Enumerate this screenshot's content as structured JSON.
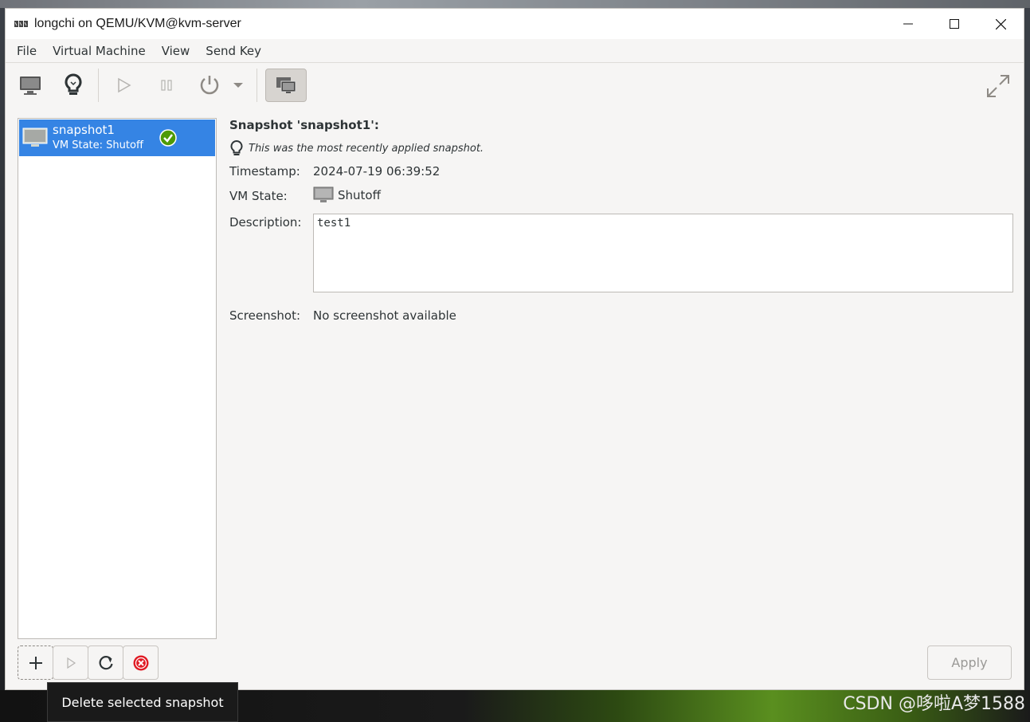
{
  "window": {
    "title": "longchi on QEMU/KVM@kvm-server"
  },
  "menubar": {
    "items": [
      "File",
      "Virtual Machine",
      "View",
      "Send Key"
    ]
  },
  "toolbar": {
    "buttons": [
      "console-icon",
      "details-bulb-icon",
      "run-icon",
      "pause-icon",
      "power-icon",
      "dropdown-arrow-icon",
      "snapshots-icon",
      "fullscreen-icon"
    ]
  },
  "snapshots": {
    "list": [
      {
        "name": "snapshot1",
        "state": "VM State: Shutoff",
        "current": true
      }
    ]
  },
  "details": {
    "heading": "Snapshot 'snapshot1':",
    "recent_note": "This was the most recently applied snapshot.",
    "timestamp_label": "Timestamp:",
    "timestamp_value": "2024-07-19 06:39:52",
    "vmstate_label": "VM State:",
    "vmstate_value": "Shutoff",
    "description_label": "Description:",
    "description_value": "test1",
    "screenshot_label": "Screenshot:",
    "screenshot_value": "No screenshot available"
  },
  "footer": {
    "apply_label": "Apply",
    "tooltip": "Delete selected snapshot"
  },
  "watermark": "CSDN @哆啦A梦1588",
  "colors": {
    "selection": "#3584e4",
    "window_bg": "#f6f5f4",
    "delete_red": "#e01b24",
    "check_green": "#4e9a06"
  }
}
